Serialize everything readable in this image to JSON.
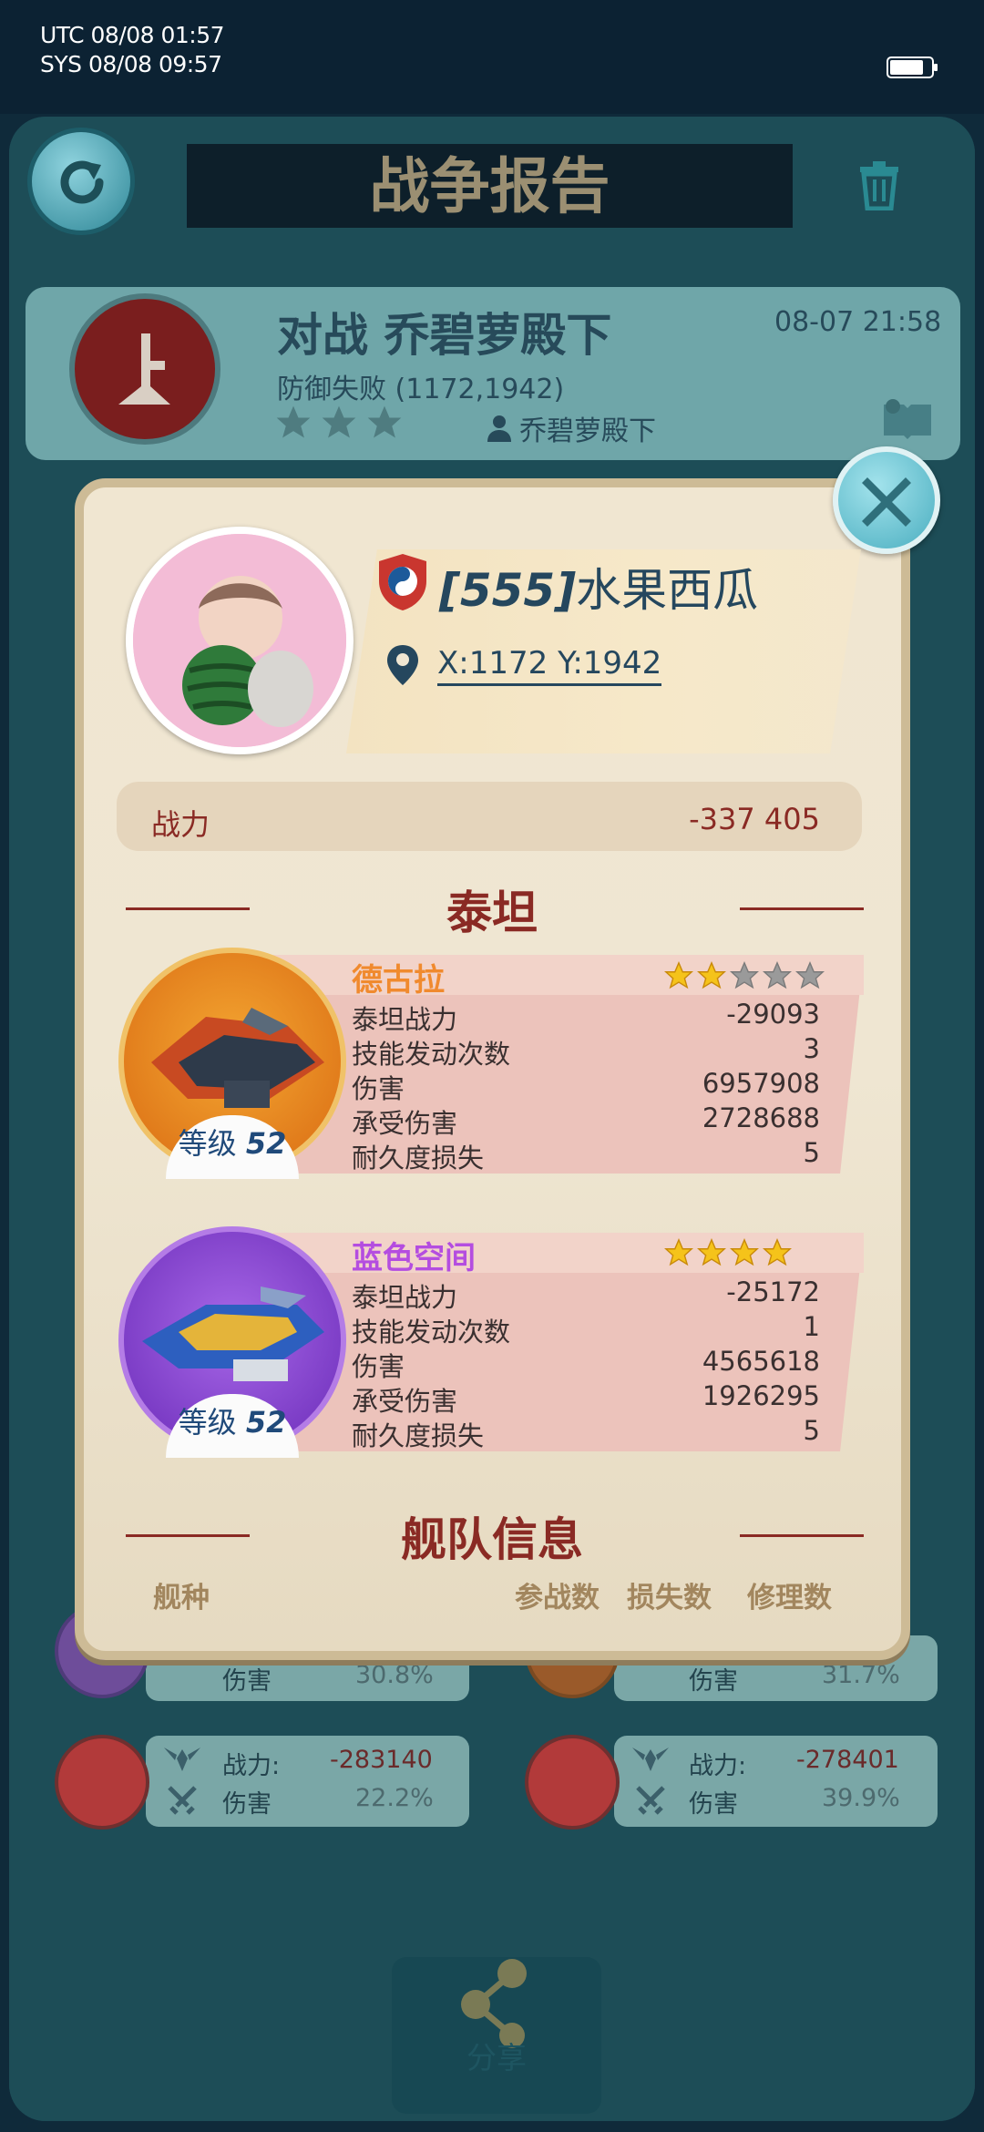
{
  "status_bar": {
    "utc": "UTC 08/08 01:57",
    "sys": "SYS 08/08 09:57"
  },
  "screen": {
    "title": "战争报告"
  },
  "report": {
    "title": "对战 乔碧萝殿下",
    "result": "防御失败 (1172,1942)",
    "time": "08-07 21:58",
    "opponent": "乔碧萝殿下",
    "stars": 0
  },
  "background_rows": [
    {
      "label": "伤害",
      "pct": "30.8%"
    },
    {
      "label": "伤害",
      "pct": "31.7%"
    },
    {
      "power_label": "战力:",
      "power": "-283140",
      "label": "伤害",
      "pct": "22.2%"
    },
    {
      "power_label": "战力:",
      "power": "-278401",
      "label": "伤害",
      "pct": "39.9%"
    }
  ],
  "share": {
    "label": "分享"
  },
  "modal": {
    "player": {
      "tag": "[555]",
      "name": "水果西瓜",
      "coords": "X:1172 Y:1942"
    },
    "power_label": "战力",
    "power_value": "-337 405",
    "titan_section": "泰坦",
    "titans": [
      {
        "name": "德古拉",
        "name_color": "#f08a2e",
        "stars": 2,
        "max_stars": 5,
        "level_label": "等级",
        "level": "52",
        "stats": [
          {
            "label": "泰坦战力",
            "value": "-29093"
          },
          {
            "label": "技能发动次数",
            "value": "3"
          },
          {
            "label": "伤害",
            "value": "6957908"
          },
          {
            "label": "承受伤害",
            "value": "2728688"
          },
          {
            "label": "耐久度损失",
            "value": "5"
          }
        ]
      },
      {
        "name": "蓝色空间",
        "name_color": "#b44de0",
        "stars": 4,
        "max_stars": 4,
        "level_label": "等级",
        "level": "52",
        "stats": [
          {
            "label": "泰坦战力",
            "value": "-25172"
          },
          {
            "label": "技能发动次数",
            "value": "1"
          },
          {
            "label": "伤害",
            "value": "4565618"
          },
          {
            "label": "承受伤害",
            "value": "1926295"
          },
          {
            "label": "耐久度损失",
            "value": "5"
          }
        ]
      }
    ],
    "fleet_section": "舰队信息",
    "fleet_headers": {
      "type": "舰种",
      "deployed": "参战数",
      "lost": "损失数",
      "repair": "修理数"
    }
  }
}
